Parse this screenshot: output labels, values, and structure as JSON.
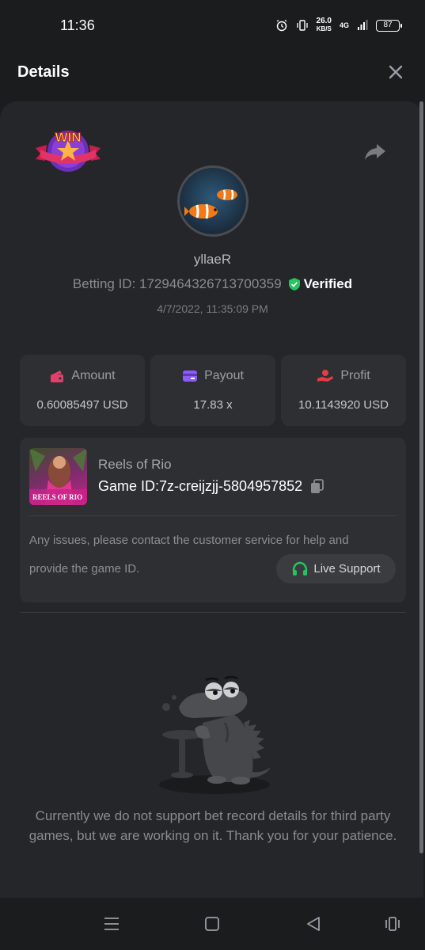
{
  "status_bar": {
    "time": "11:36",
    "net_speed_value": "26.0",
    "net_speed_unit": "KB/S",
    "network": "4G",
    "battery": "87"
  },
  "header": {
    "title": "Details"
  },
  "profile": {
    "badge_text": "WIN",
    "username": "yllaeR",
    "betting_id_label": "Betting ID: 1729464326713700359",
    "verified_label": "Verified",
    "timestamp": "4/7/2022, 11:35:09 PM"
  },
  "stats": [
    {
      "label": "Amount",
      "value": "0.60085497 USD",
      "icon": "wallet-icon",
      "color": "#e0416b"
    },
    {
      "label": "Payout",
      "value": "17.83 x",
      "icon": "payout-card-icon",
      "color": "#8b5cf6"
    },
    {
      "label": "Profit",
      "value": "10.1143920 USD",
      "icon": "profit-hand-icon",
      "color": "#e53e3e"
    }
  ],
  "game": {
    "thumb_text": "REELS OF RIO",
    "name": "Reels of Rio",
    "game_id_label": "Game ID:",
    "game_id_value": "7z-creijzjj-5804957852",
    "issue_line1": "Any issues, please contact the customer service for help and",
    "issue_line2": "provide the game ID.",
    "support_label": "Live Support"
  },
  "empty_state": {
    "message": "Currently we do not support bet record details for third party games, but we are working on it. Thank you for your patience."
  },
  "colors": {
    "accent_green": "#22c55e",
    "background": "#1b1c1e",
    "panel": "#24262a",
    "card": "#2d2f33"
  }
}
